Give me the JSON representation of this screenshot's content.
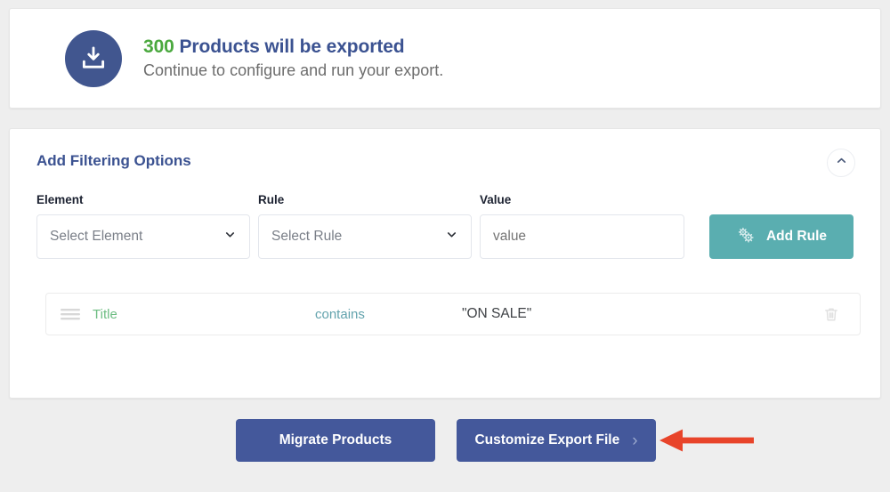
{
  "summary": {
    "count": "300",
    "title_rest": " Products will be exported",
    "subtitle": "Continue to configure and run your export.",
    "icon": "export-download-icon",
    "badge_color": "#41568f",
    "count_color": "#4ba93f",
    "title_color": "#3b5291"
  },
  "filter_panel": {
    "heading": "Add Filtering Options",
    "collapse_icon": "chevron-up-icon",
    "labels": {
      "element": "Element",
      "rule": "Rule",
      "value": "Value"
    },
    "element_select": {
      "value": "Select Element",
      "chevron": "chevron-down-icon"
    },
    "rule_select": {
      "value": "Select Rule",
      "chevron": "chevron-down-icon"
    },
    "value_input": {
      "value": "",
      "placeholder": "value"
    },
    "add_rule_button": {
      "label": "Add Rule",
      "icon": "gears-icon",
      "color": "#5aaeb0"
    },
    "rules": [
      {
        "handle_icon": "drag-handle-icon",
        "element": "Title",
        "condition": "contains",
        "value": "\"ON SALE\"",
        "delete_icon": "trash-icon"
      }
    ]
  },
  "footer": {
    "migrate_button": "Migrate Products",
    "customize_button": "Customize Export File",
    "customize_chevron": "chevron-right-icon",
    "button_color": "#44589b"
  },
  "annotation": {
    "type": "arrow-left",
    "color": "#e8442a"
  }
}
